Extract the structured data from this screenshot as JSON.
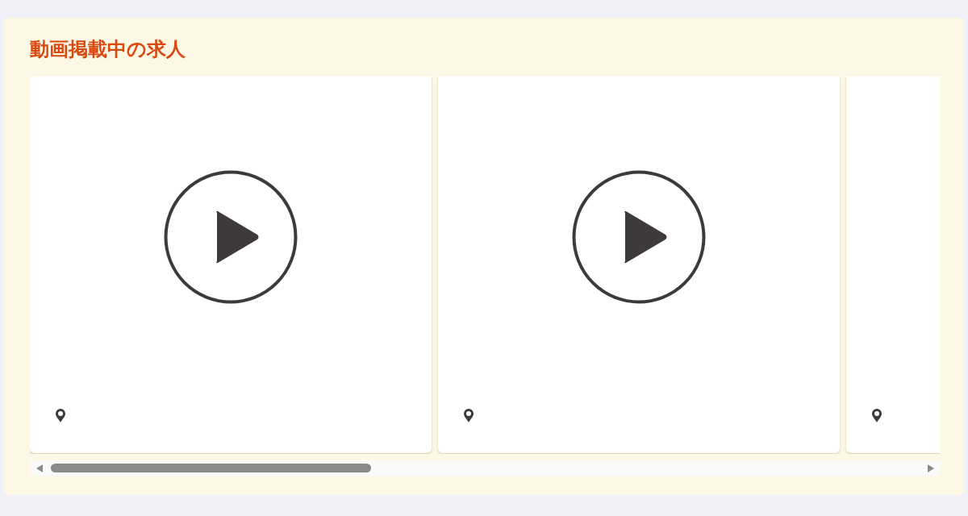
{
  "section": {
    "title": "動画掲載中の求人"
  },
  "cards": [
    {
      "kind": "video"
    },
    {
      "kind": "video"
    },
    {
      "kind": "video"
    }
  ]
}
